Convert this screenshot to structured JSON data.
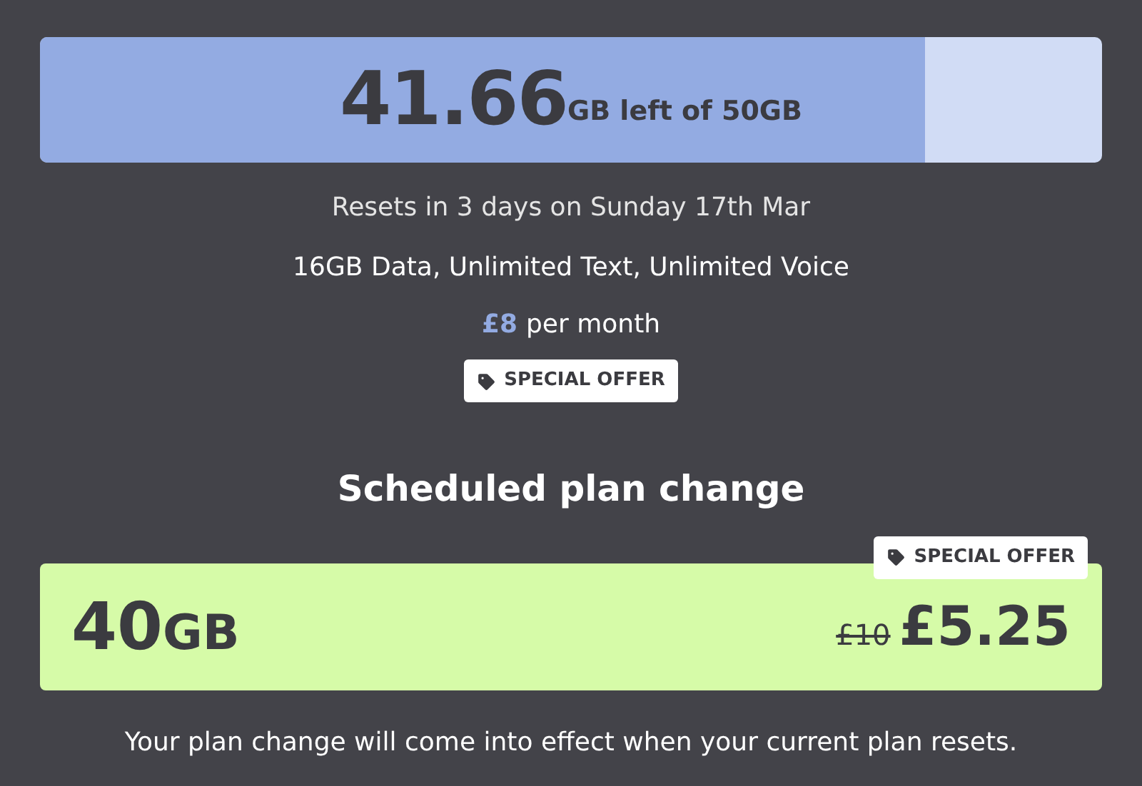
{
  "usage": {
    "amount": "41.66",
    "unit_text": "GB left of 50GB",
    "level": 0.833
  },
  "resets": "Resets in 3 days on Sunday 17th Mar",
  "plan": "16GB Data, Unlimited Text, Unlimited Voice",
  "price": {
    "amount": "£8",
    "period": "per month"
  },
  "current_badge": "SPECIAL OFFER",
  "scheduled": {
    "heading": "Scheduled plan change",
    "badge": "SPECIAL OFFER",
    "data": "40",
    "data_unit": "GB",
    "old_price": "£10",
    "new_price": "£5.25"
  },
  "note": "Your plan change will come into effect when your current plan resets."
}
